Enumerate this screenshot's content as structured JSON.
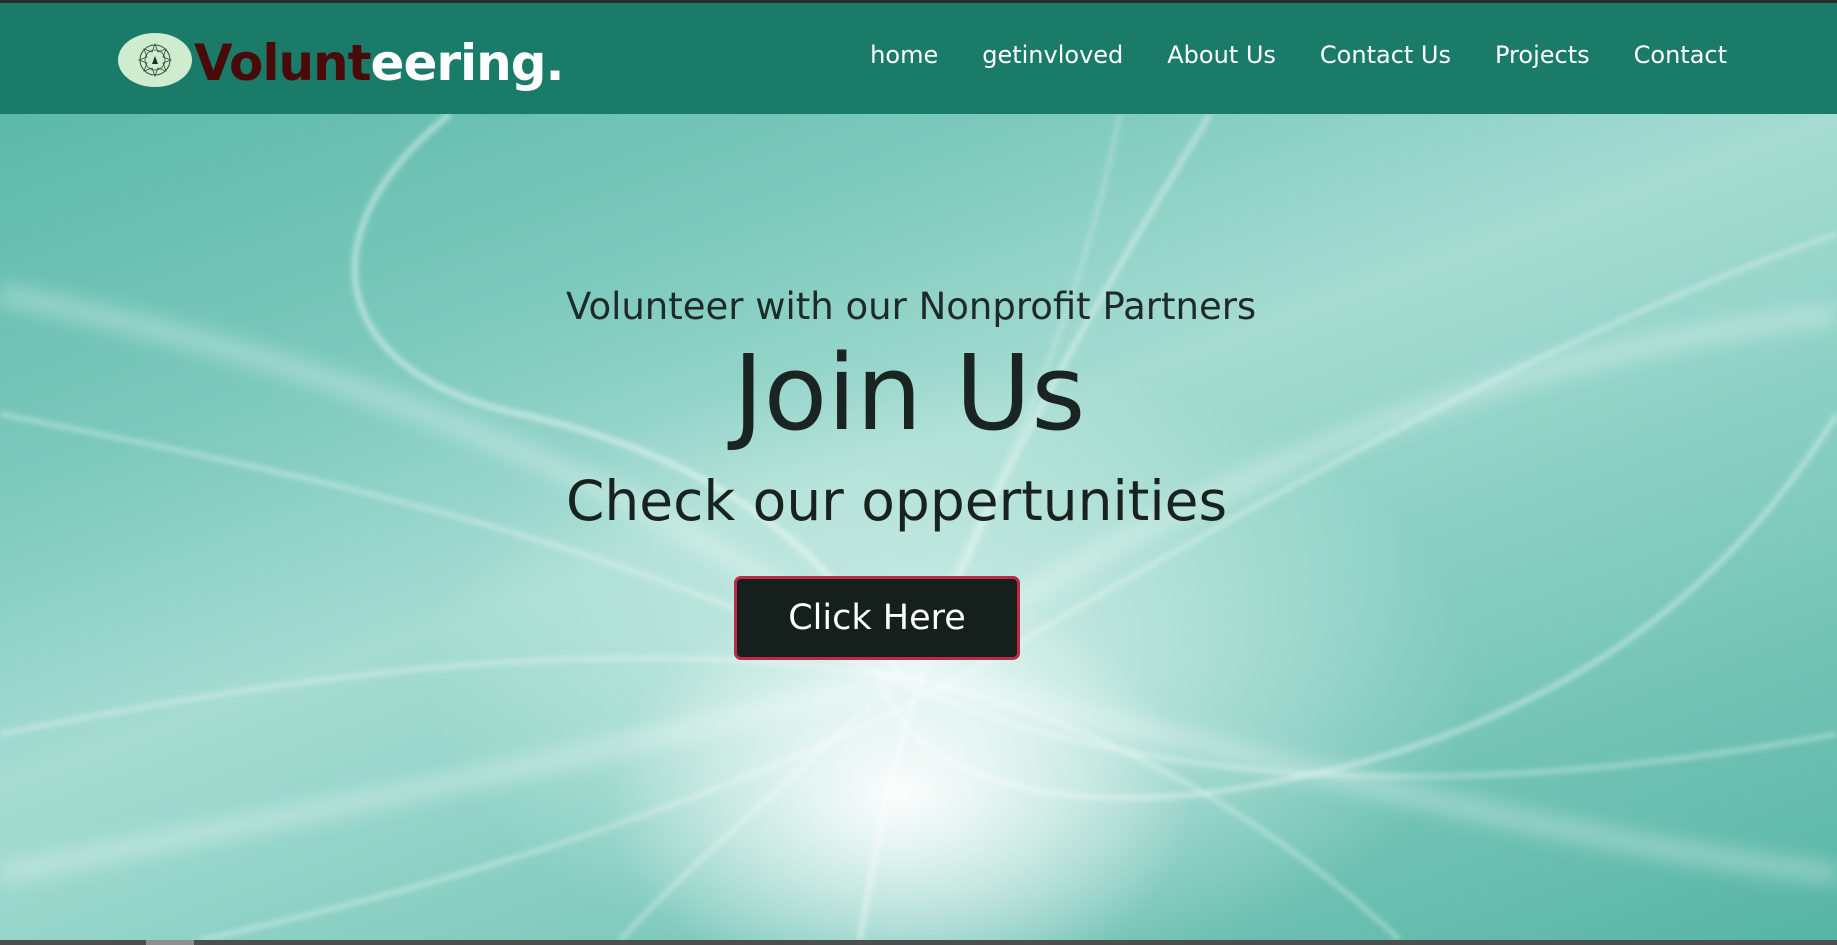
{
  "brand": {
    "name_dark": "Volunt",
    "name_light": "eering.",
    "logo_icon": "emblem-icon"
  },
  "nav": {
    "items": [
      {
        "label": "home"
      },
      {
        "label": "getinvloved"
      },
      {
        "label": "About Us"
      },
      {
        "label": "Contact Us"
      },
      {
        "label": "Projects"
      },
      {
        "label": "Contact"
      }
    ]
  },
  "hero": {
    "subtitle": "Volunteer with our Nonprofit Partners",
    "title": "Join Us",
    "tagline": "Check our oppertunities",
    "cta_label": "Click Here"
  },
  "colors": {
    "navbar": "#1b7b69",
    "brand_dark": "#4a0a0a",
    "cta_bg": "#15201d",
    "cta_border": "#c0284a"
  }
}
